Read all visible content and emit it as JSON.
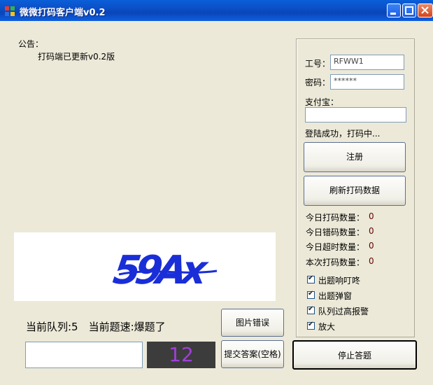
{
  "window": {
    "title": "微微打码客户端v0.2"
  },
  "notice": {
    "label": "公告：",
    "text": "打码端已更新v0.2版"
  },
  "login": {
    "id_label": "工号：",
    "id_value": "RFWW1",
    "pwd_label": "密码：",
    "pwd_value": "******",
    "alipay_label": "支付宝：",
    "alipay_value": "",
    "status": "登陆成功，打码中..."
  },
  "buttons": {
    "register": "注册",
    "refresh": "刷新打码数据",
    "image_error": "图片错误",
    "submit": "提交答案(空格)",
    "stop": "停止答题"
  },
  "stats": [
    {
      "label": "今日打码数量：",
      "value": "0"
    },
    {
      "label": "今日错码数量：",
      "value": "0"
    },
    {
      "label": "今日超时数量：",
      "value": "0"
    },
    {
      "label": "本次打码数量：",
      "value": "0"
    }
  ],
  "options": [
    {
      "label": "出题响叮咚",
      "checked": true
    },
    {
      "label": "出题弹窗",
      "checked": true
    },
    {
      "label": "队列过高报警",
      "checked": true
    },
    {
      "label": "放大",
      "checked": true
    }
  ],
  "queue": {
    "text": "当前队列:5　当前题速:爆题了"
  },
  "captcha": {
    "text": "59Ax"
  },
  "answer": {
    "value": ""
  },
  "counter": {
    "value": "12"
  }
}
